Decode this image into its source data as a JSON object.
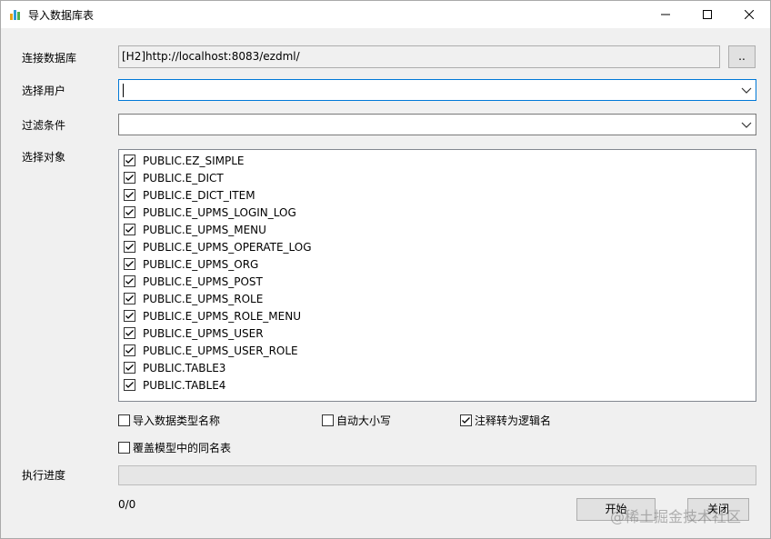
{
  "window": {
    "title": "导入数据库表",
    "icon": "app-bar-chart-icon"
  },
  "form": {
    "connection_label": "连接数据库",
    "connection_value": "[H2]http://localhost:8083/ezdml/",
    "browse_label": "..",
    "user_label": "选择用户",
    "user_value": "",
    "filter_label": "过滤条件",
    "filter_value": "",
    "objects_label": "选择对象"
  },
  "objects": [
    {
      "name": "PUBLIC.EZ_SIMPLE",
      "checked": true
    },
    {
      "name": "PUBLIC.E_DICT",
      "checked": true
    },
    {
      "name": "PUBLIC.E_DICT_ITEM",
      "checked": true
    },
    {
      "name": "PUBLIC.E_UPMS_LOGIN_LOG",
      "checked": true
    },
    {
      "name": "PUBLIC.E_UPMS_MENU",
      "checked": true
    },
    {
      "name": "PUBLIC.E_UPMS_OPERATE_LOG",
      "checked": true
    },
    {
      "name": "PUBLIC.E_UPMS_ORG",
      "checked": true
    },
    {
      "name": "PUBLIC.E_UPMS_POST",
      "checked": true
    },
    {
      "name": "PUBLIC.E_UPMS_ROLE",
      "checked": true
    },
    {
      "name": "PUBLIC.E_UPMS_ROLE_MENU",
      "checked": true
    },
    {
      "name": "PUBLIC.E_UPMS_USER",
      "checked": true
    },
    {
      "name": "PUBLIC.E_UPMS_USER_ROLE",
      "checked": true
    },
    {
      "name": "PUBLIC.TABLE3",
      "checked": true
    },
    {
      "name": "PUBLIC.TABLE4",
      "checked": true
    }
  ],
  "options": {
    "import_types": {
      "label": "导入数据类型名称",
      "checked": false
    },
    "auto_case": {
      "label": "自动大小写",
      "checked": false
    },
    "comment_to_logic": {
      "label": "注释转为逻辑名",
      "checked": true
    },
    "overwrite_same": {
      "label": "覆盖模型中的同名表",
      "checked": false
    }
  },
  "progress": {
    "label": "执行进度",
    "fraction": 0,
    "counter": "0/0"
  },
  "buttons": {
    "start": "开始",
    "close": "关闭"
  },
  "watermark": "@稀土掘金技术社区"
}
